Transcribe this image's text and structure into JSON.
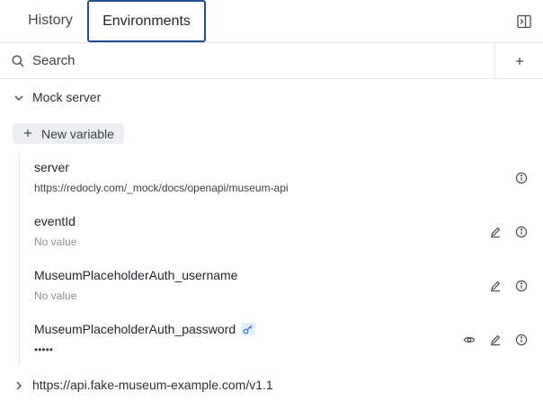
{
  "tabs": [
    {
      "label": "History",
      "active": false
    },
    {
      "label": "Environments",
      "active": true
    }
  ],
  "search": {
    "placeholder": "Search",
    "value": ""
  },
  "groups": [
    {
      "label": "Mock server",
      "expanded": true
    },
    {
      "label": "https://api.fake-museum-example.com/v1.1",
      "expanded": false
    }
  ],
  "new_variable_label": "New variable",
  "variables": [
    {
      "name": "server",
      "value": "https://redocly.com/_mock/docs/openapi/museum-api",
      "empty": false,
      "secret": false,
      "actions": [
        "info-icon"
      ]
    },
    {
      "name": "eventId",
      "value": "No value",
      "empty": true,
      "secret": false,
      "actions": [
        "pencil-icon",
        "info-icon"
      ]
    },
    {
      "name": "MuseumPlaceholderAuth_username",
      "value": "No value",
      "empty": true,
      "secret": false,
      "actions": [
        "pencil-icon",
        "info-icon"
      ]
    },
    {
      "name": "MuseumPlaceholderAuth_password",
      "value": "•••••",
      "empty": false,
      "secret": true,
      "actions": [
        "eye-icon",
        "pencil-icon",
        "info-icon"
      ]
    }
  ],
  "colors": {
    "active_tab_border": "#1f4e8c",
    "secret_badge": "#e3ecfb",
    "secret_icon": "#2f6fd6"
  }
}
